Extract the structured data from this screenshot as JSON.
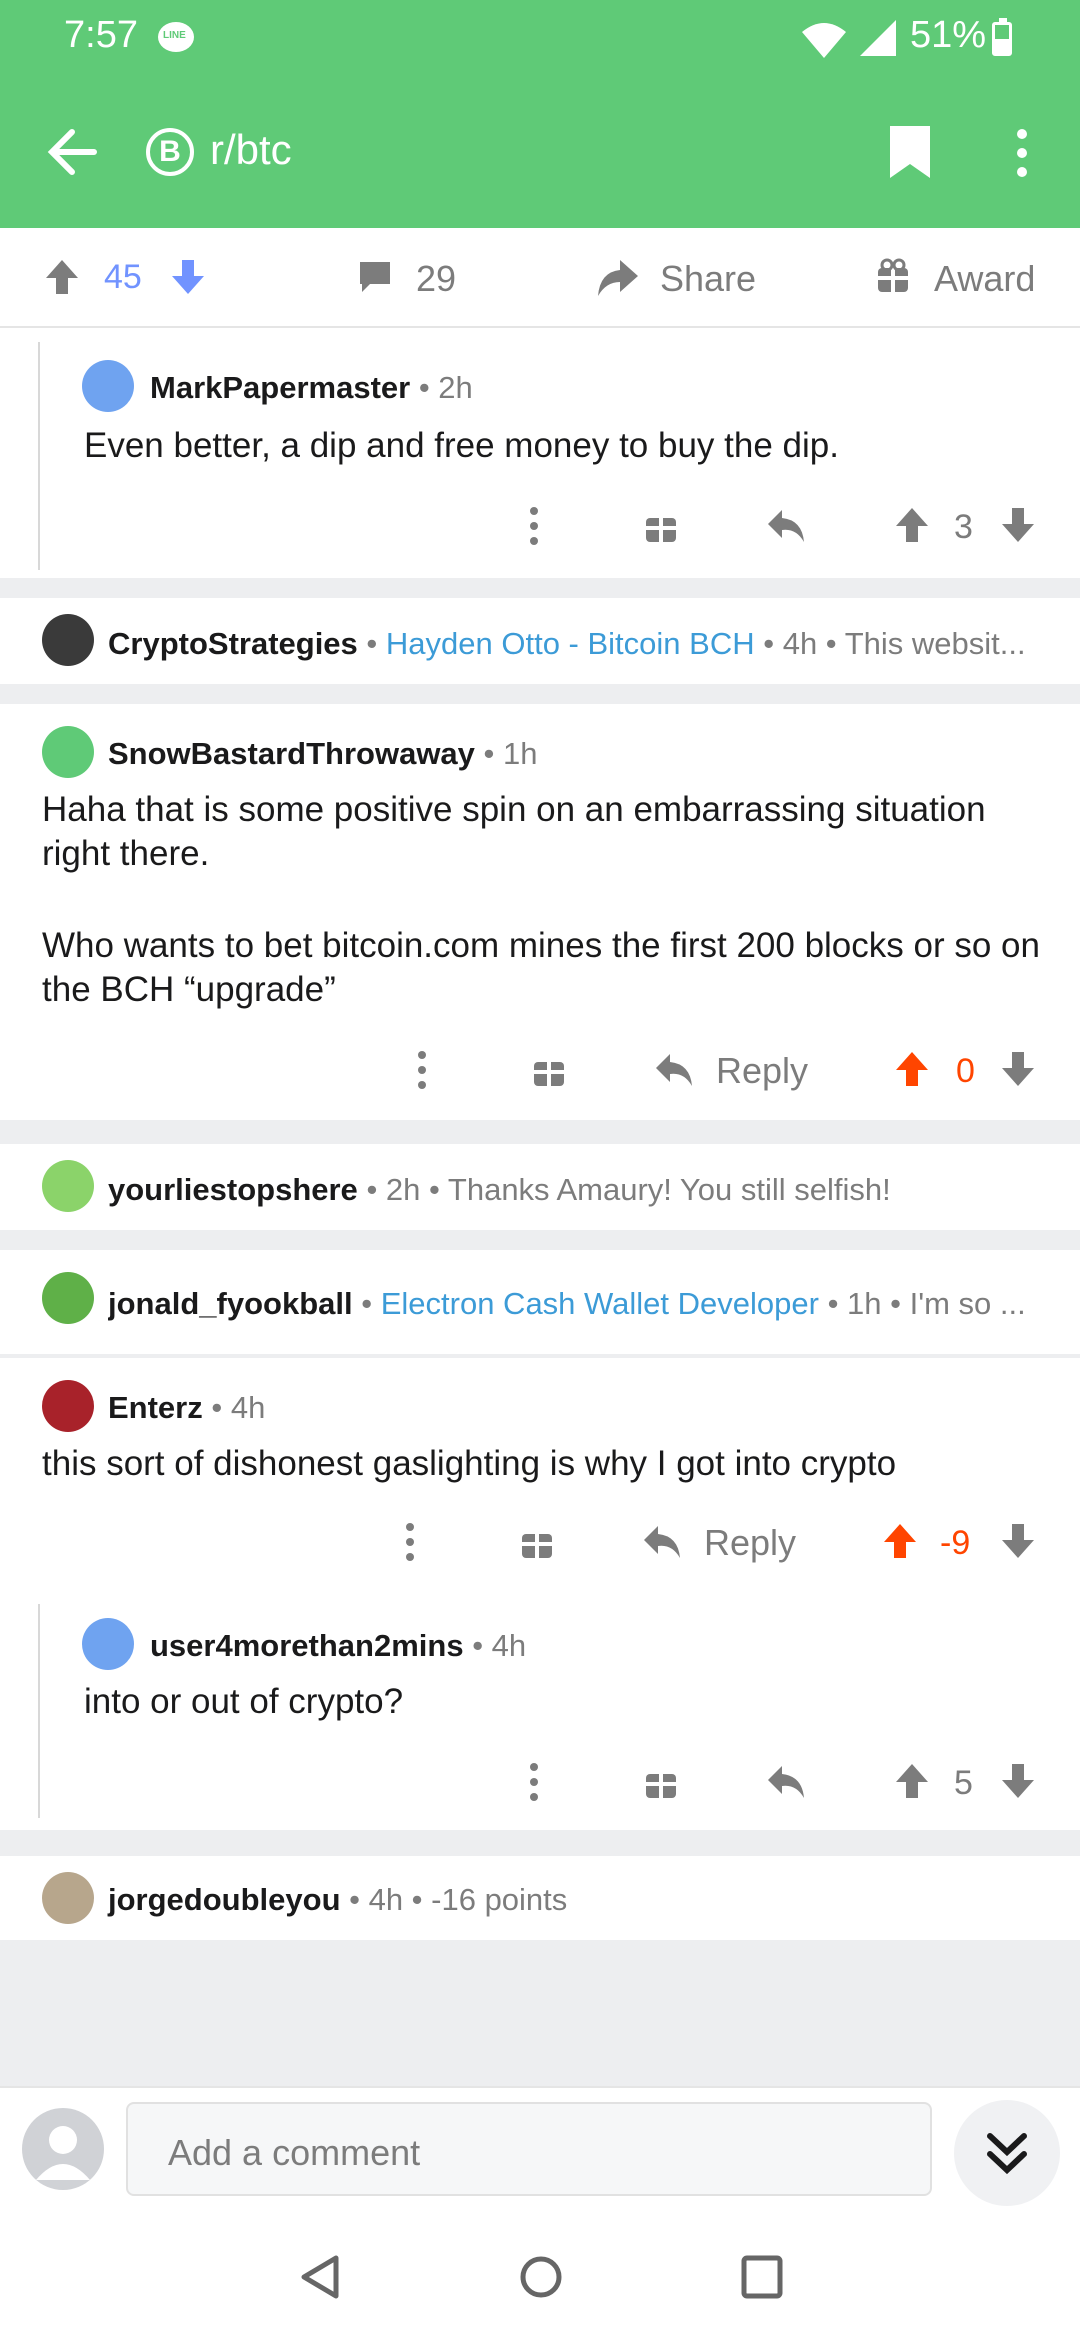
{
  "status": {
    "time": "7:57",
    "battery": "51%"
  },
  "header": {
    "subreddit": "r/btc",
    "sub_icon_letter": "B"
  },
  "post_actions": {
    "score": "45",
    "comments": "29",
    "share": "Share",
    "award": "Award"
  },
  "comments": [
    {
      "author": "MarkPapermaster",
      "meta": "• 2h",
      "body": "Even better, a dip and free money to buy the dip.",
      "score": "3"
    },
    {
      "author": "CryptoStrategies",
      "flair": "Hayden Otto - Bitcoin BCH",
      "meta": "• 4h • This websit..."
    },
    {
      "author": "SnowBastardThrowaway",
      "meta": "• 1h",
      "body1": "Haha that is some positive spin on an embarrassing situation right there.",
      "body2": "Who wants to bet bitcoin.com mines the first 200 blocks or so on the BCH “upgrade”",
      "reply": "Reply",
      "score": "0"
    },
    {
      "author": "yourliestopshere",
      "meta": "• 2h • Thanks Amaury!  You still selfish!"
    },
    {
      "author": "jonald_fyookball",
      "flair": "Electron Cash Wallet Developer",
      "meta": "• 1h • I'm so ..."
    },
    {
      "author": "Enterz",
      "meta": "• 4h",
      "body": "this sort of dishonest gaslighting is why I got into crypto",
      "reply": "Reply",
      "score": "-9"
    },
    {
      "author": "user4morethan2mins",
      "meta": "• 4h",
      "body": "into or out of crypto?",
      "score": "5"
    },
    {
      "author": "jorgedoubleyou",
      "meta": "• 4h • -16 points"
    }
  ],
  "composer": {
    "placeholder": "Add a comment"
  },
  "colors": {
    "brand_green": "#5fca77",
    "upvote_orange": "#ff4500",
    "upvote_blue": "#7193ff",
    "flair_blue": "#3c9bd7"
  }
}
